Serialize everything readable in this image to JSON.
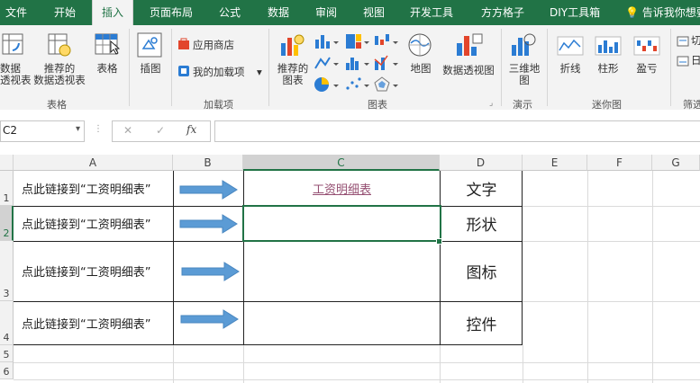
{
  "tabs": [
    "文件",
    "开始",
    "插入",
    "页面布局",
    "公式",
    "数据",
    "审阅",
    "视图",
    "开发工具",
    "方方格子",
    "DIY工具箱"
  ],
  "active_tab": "插入",
  "tell_me": "告诉我你想要",
  "ribbon": {
    "pivot_table": [
      "数据",
      "透视表"
    ],
    "recommended_pivot": [
      "推荐的",
      "数据透视表"
    ],
    "table": "表格",
    "group_tables": "表格",
    "illustrations": "插图",
    "app_store": "应用商店",
    "my_addins": "我的加载项",
    "group_addins": "加载项",
    "recommended_charts": [
      "推荐的",
      "图表"
    ],
    "map": "地图",
    "pivot_chart": "数据透视图",
    "group_charts": "图表",
    "map3d": [
      "三维地",
      "图"
    ],
    "group_tours": "演示",
    "spark_line": "折线",
    "spark_column": "柱形",
    "spark_winloss": "盈亏",
    "group_sparklines": "迷你图",
    "right_cut_1": "切",
    "right_cut_2": "日",
    "group_filter_cut": "筛选"
  },
  "formula_bar": {
    "name_box": "C2",
    "cancel": "✕",
    "enter": "✓",
    "fx": "fx",
    "formula": ""
  },
  "columns": [
    "A",
    "B",
    "C",
    "D",
    "E",
    "F",
    "G"
  ],
  "rows": [
    "1",
    "2",
    "3",
    "4",
    "5",
    "6"
  ],
  "cells": {
    "A1": "点此链接到“工资明细表”",
    "A2": "点此链接到“工资明细表”",
    "A3": "点此链接到“工资明细表”",
    "A4": "点此链接到“工资明细表”",
    "C1": "工资明细表",
    "D1": "文字",
    "D2": "形状",
    "D3": "图标",
    "D4": "控件"
  },
  "colors": {
    "accent": "#217346",
    "arrow": "#5b9bd5",
    "hyperlink": "#954f72"
  }
}
